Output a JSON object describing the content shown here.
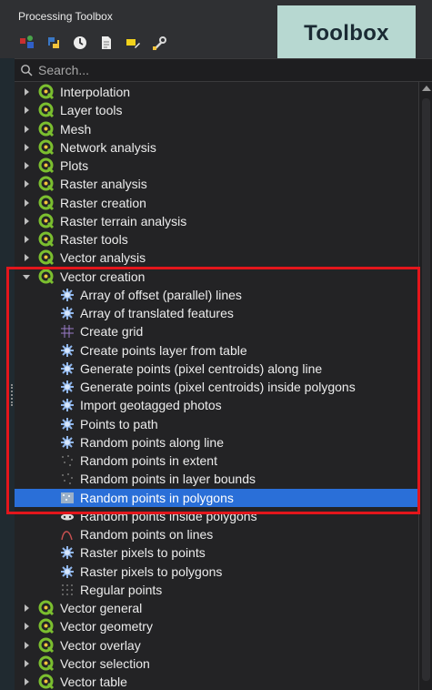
{
  "panel": {
    "title": "Processing Toolbox",
    "badge": "Toolbox"
  },
  "toolbar": {
    "icons": [
      "models-icon",
      "python-scripts-icon",
      "history-icon",
      "results-viewer-icon",
      "edit-features-icon",
      "options-wrench-icon"
    ]
  },
  "search": {
    "placeholder": "Search..."
  },
  "tree": {
    "groups_before": [
      "Interpolation",
      "Layer tools",
      "Mesh",
      "Network analysis",
      "Plots",
      "Raster analysis",
      "Raster creation",
      "Raster terrain analysis",
      "Raster tools",
      "Vector analysis"
    ],
    "expanded_group": "Vector creation",
    "algorithms": [
      "Array of offset (parallel) lines",
      "Array of translated features",
      "Create grid",
      "Create points layer from table",
      "Generate points (pixel centroids) along line",
      "Generate points (pixel centroids) inside polygons",
      "Import geotagged photos",
      "Points to path",
      "Random points along line",
      "Random points in extent",
      "Random points in layer bounds",
      "Random points in polygons",
      "Random points inside polygons",
      "Random points on lines",
      "Raster pixels to points",
      "Raster pixels to polygons",
      "Regular points"
    ],
    "selected": "Random points in polygons",
    "groups_after": [
      "Vector general",
      "Vector geometry",
      "Vector overlay",
      "Vector selection",
      "Vector table"
    ]
  },
  "colors": {
    "selection": "#2a6fd8",
    "highlight_box": "#e3161c",
    "qgis_green": "#7bbf2f",
    "badge": "#b7d8d1"
  }
}
